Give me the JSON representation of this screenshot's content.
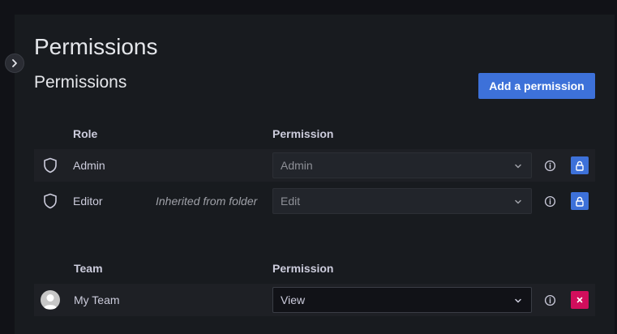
{
  "page": {
    "title": "Permissions",
    "section_title": "Permissions",
    "add_button_label": "Add a permission"
  },
  "roles_table": {
    "col_role": "Role",
    "col_permission": "Permission",
    "rows": [
      {
        "name": "Admin",
        "inherited": "",
        "permission": "Admin",
        "icon": "shield-icon",
        "action": "lock-icon"
      },
      {
        "name": "Editor",
        "inherited": "Inherited from folder",
        "permission": "Edit",
        "icon": "shield-icon",
        "action": "lock-icon"
      }
    ]
  },
  "teams_table": {
    "col_team": "Team",
    "col_permission": "Permission",
    "rows": [
      {
        "name": "My Team",
        "permission": "View",
        "icon": "avatar",
        "action": "close-icon"
      }
    ]
  },
  "colors": {
    "primary": "#3d71d9",
    "danger": "#d10e5c",
    "background": "#181b1f"
  }
}
